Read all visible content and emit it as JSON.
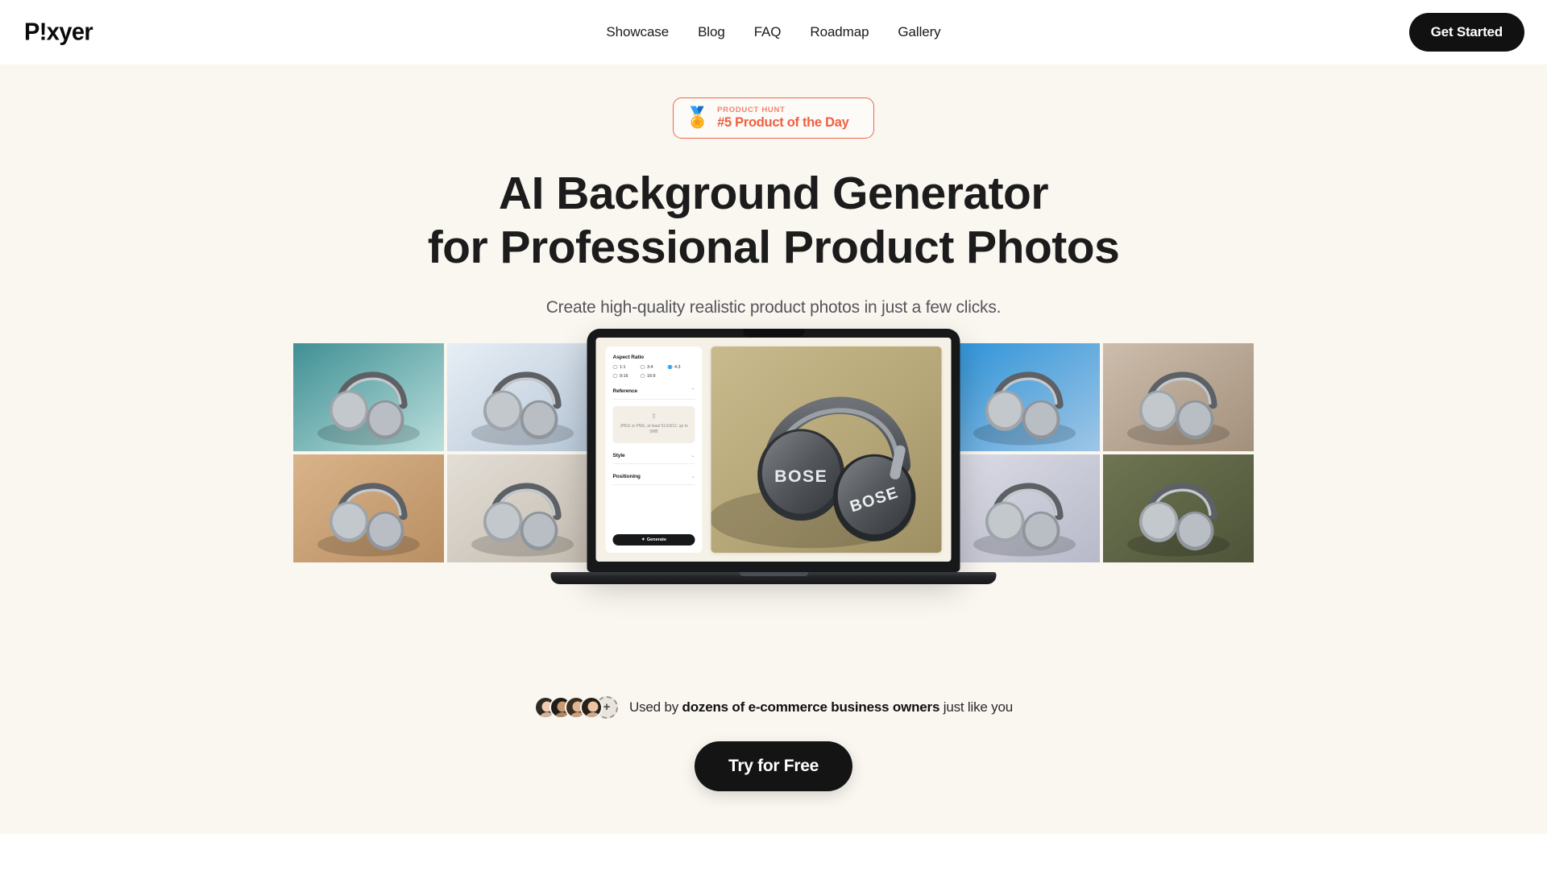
{
  "brand": {
    "logo_text": "P!xyer"
  },
  "nav": {
    "links": [
      {
        "label": "Showcase"
      },
      {
        "label": "Blog"
      },
      {
        "label": "FAQ"
      },
      {
        "label": "Roadmap"
      },
      {
        "label": "Gallery"
      }
    ],
    "cta_label": "Get Started"
  },
  "hero": {
    "badge": {
      "medal_icon": "medal-icon",
      "medal_glyph": "🏅",
      "rank_digit": "5",
      "kicker": "PRODUCT HUNT",
      "title": "#5 Product of the Day",
      "border_color": "#f16548",
      "title_color": "#f05f41"
    },
    "headline_line1": "AI Background Generator",
    "headline_line2": "for Professional Product Photos",
    "subhead": "Create high-quality realistic product photos in just a few clicks.",
    "background_color": "#faf6f0",
    "social_proof": {
      "prefix": "Used by ",
      "emphasis": "dozens of e-commerce business owners",
      "suffix": " just like you",
      "plus_glyph": "+",
      "avatar_count": 4
    },
    "cta_label": "Try for Free"
  },
  "app_preview": {
    "aspect_ratio": {
      "label": "Aspect Ratio",
      "options": [
        {
          "label": "1:1",
          "selected": false
        },
        {
          "label": "3:4",
          "selected": false
        },
        {
          "label": "4:3",
          "selected": true
        },
        {
          "label": "9:16",
          "selected": false
        },
        {
          "label": "16:9",
          "selected": false
        }
      ],
      "selected_value": "4:3",
      "accent_color": "#2b9cf0"
    },
    "reference": {
      "label": "Reference",
      "chevron": "⌃",
      "upload_icon": "upload-icon",
      "upload_glyph": "⇧",
      "hint": "JPEG or PNG, at least 512x512, up to 5MB"
    },
    "style": {
      "label": "Style",
      "chevron": "⌄"
    },
    "positioning": {
      "label": "Positioning",
      "chevron": "⌄"
    },
    "generate": {
      "label": "Generate",
      "icon_glyph": "✦"
    },
    "preview_caption": "BOSE"
  },
  "gallery": {
    "left": [
      {
        "name": "teal-ribbon-abstract",
        "c1": "#3f9094",
        "c2": "#bcdfdd"
      },
      {
        "name": "cloudscape",
        "c1": "#e7eef5",
        "c2": "#b6c6d6"
      },
      {
        "name": "sunlit-wall-shadow",
        "c1": "#ded5c6",
        "c2": "#bcae9b"
      },
      {
        "name": "warm-sand-shadow",
        "c1": "#d9b38a",
        "c2": "#b98f62"
      },
      {
        "name": "window-light-linen",
        "c1": "#e3ded6",
        "c2": "#c3bbaf"
      },
      {
        "name": "peach-fabric-drape",
        "c1": "#e8a583",
        "c2": "#cf7f5c"
      }
    ],
    "right": [
      {
        "name": "forest-stream",
        "c1": "#7b8c5e",
        "c2": "#46512f"
      },
      {
        "name": "blue-ice-peaks",
        "c1": "#2e93d8",
        "c2": "#9ec6e6"
      },
      {
        "name": "desert-rock-canyon",
        "c1": "#cdbdac",
        "c2": "#a3907c"
      },
      {
        "name": "cozy-interior-plant",
        "c1": "#e6e0d5",
        "c2": "#c4bcae"
      },
      {
        "name": "lavender-studio",
        "c1": "#dcdce6",
        "c2": "#b7b9c9"
      },
      {
        "name": "olive-wall-wood",
        "c1": "#6e7552",
        "c2": "#4e5439"
      }
    ]
  }
}
